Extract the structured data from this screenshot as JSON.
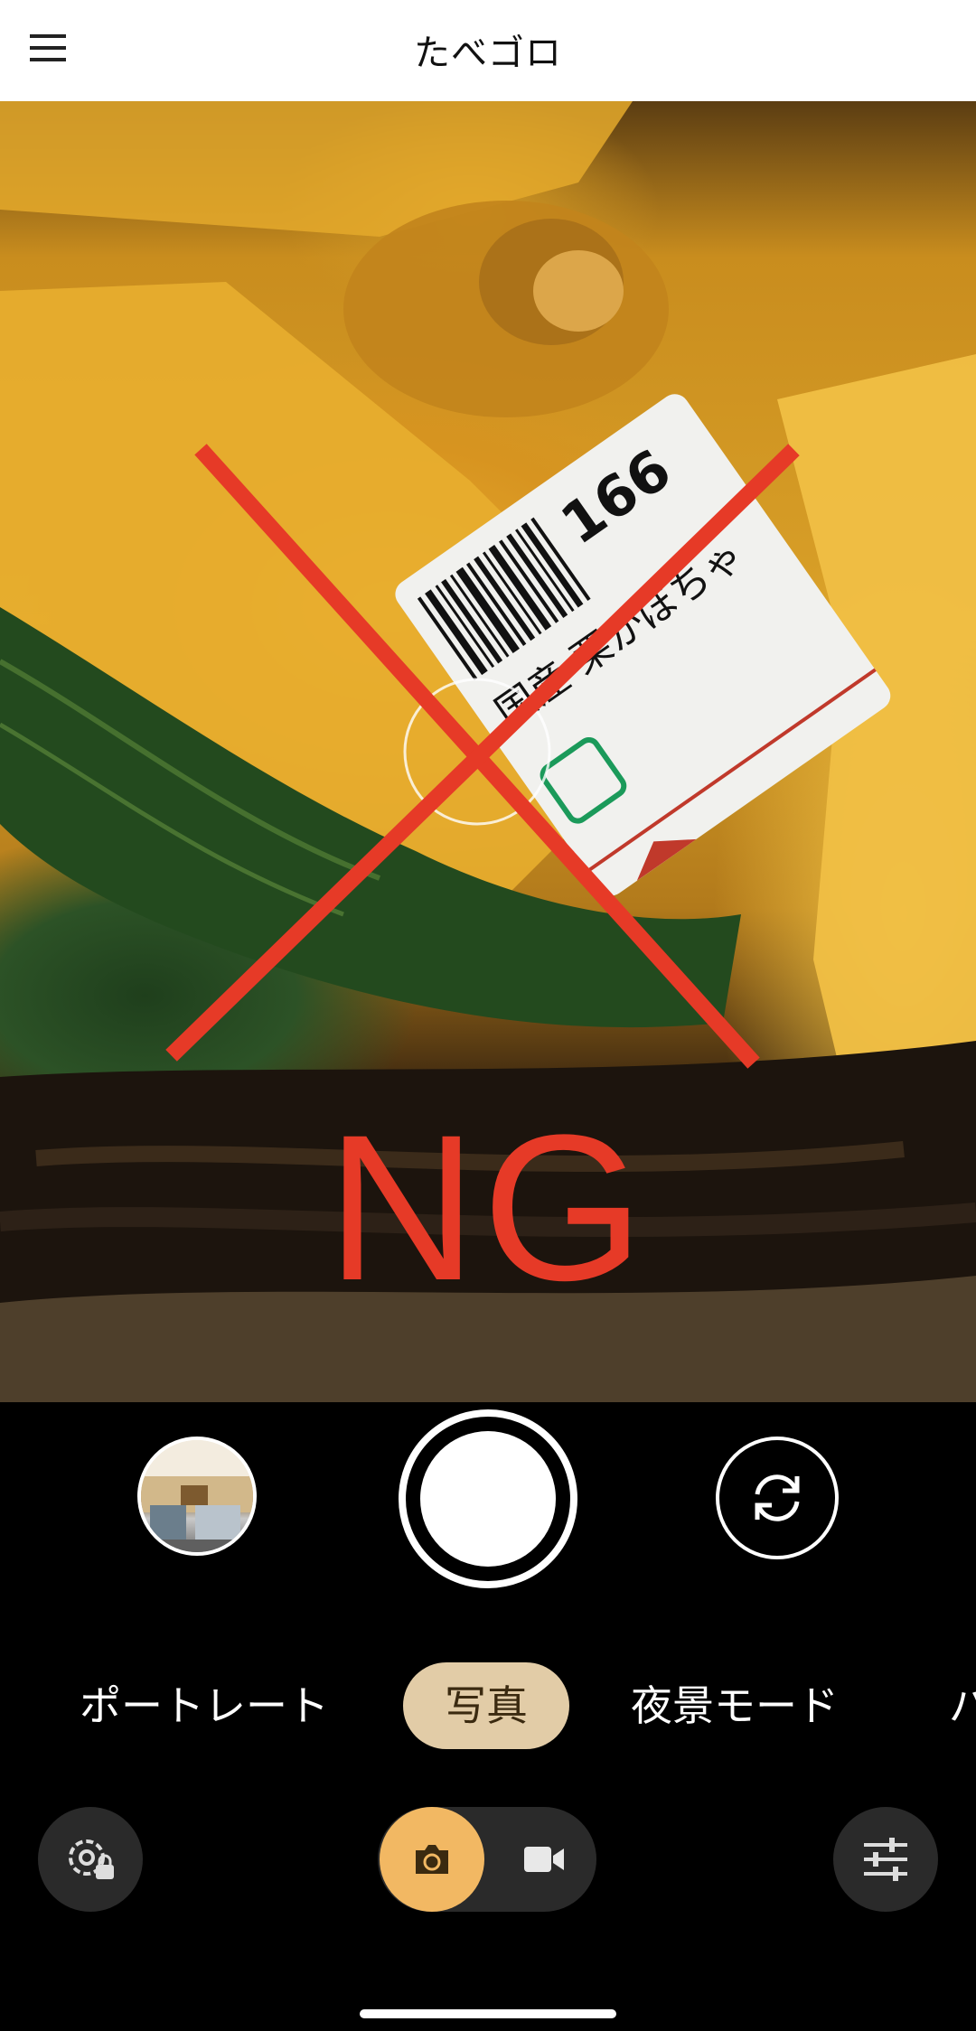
{
  "app_bar": {
    "title": "たべゴロ",
    "menu_icon": "hamburger-menu-icon"
  },
  "viewfinder": {
    "overlay_text": "NG",
    "overlay_color": "#e63a27",
    "label_price": "166",
    "label_text": "国産 栗かぼちゃ"
  },
  "camera_controls": {
    "gallery_thumbnail": "recent-photo-thumbnail",
    "shutter_icon": "shutter-button",
    "switch_camera_icon": "switch-camera-icon"
  },
  "modes": {
    "items": [
      "ポートレート",
      "写真",
      "夜景モード",
      "パ"
    ],
    "selected": "写真"
  },
  "bottom_bar": {
    "settings_icon": "camera-settings-icon",
    "photo_mode_icon": "camera-icon",
    "video_mode_icon": "video-icon",
    "adjust_icon": "sliders-icon",
    "accent_color": "#f2b863"
  }
}
